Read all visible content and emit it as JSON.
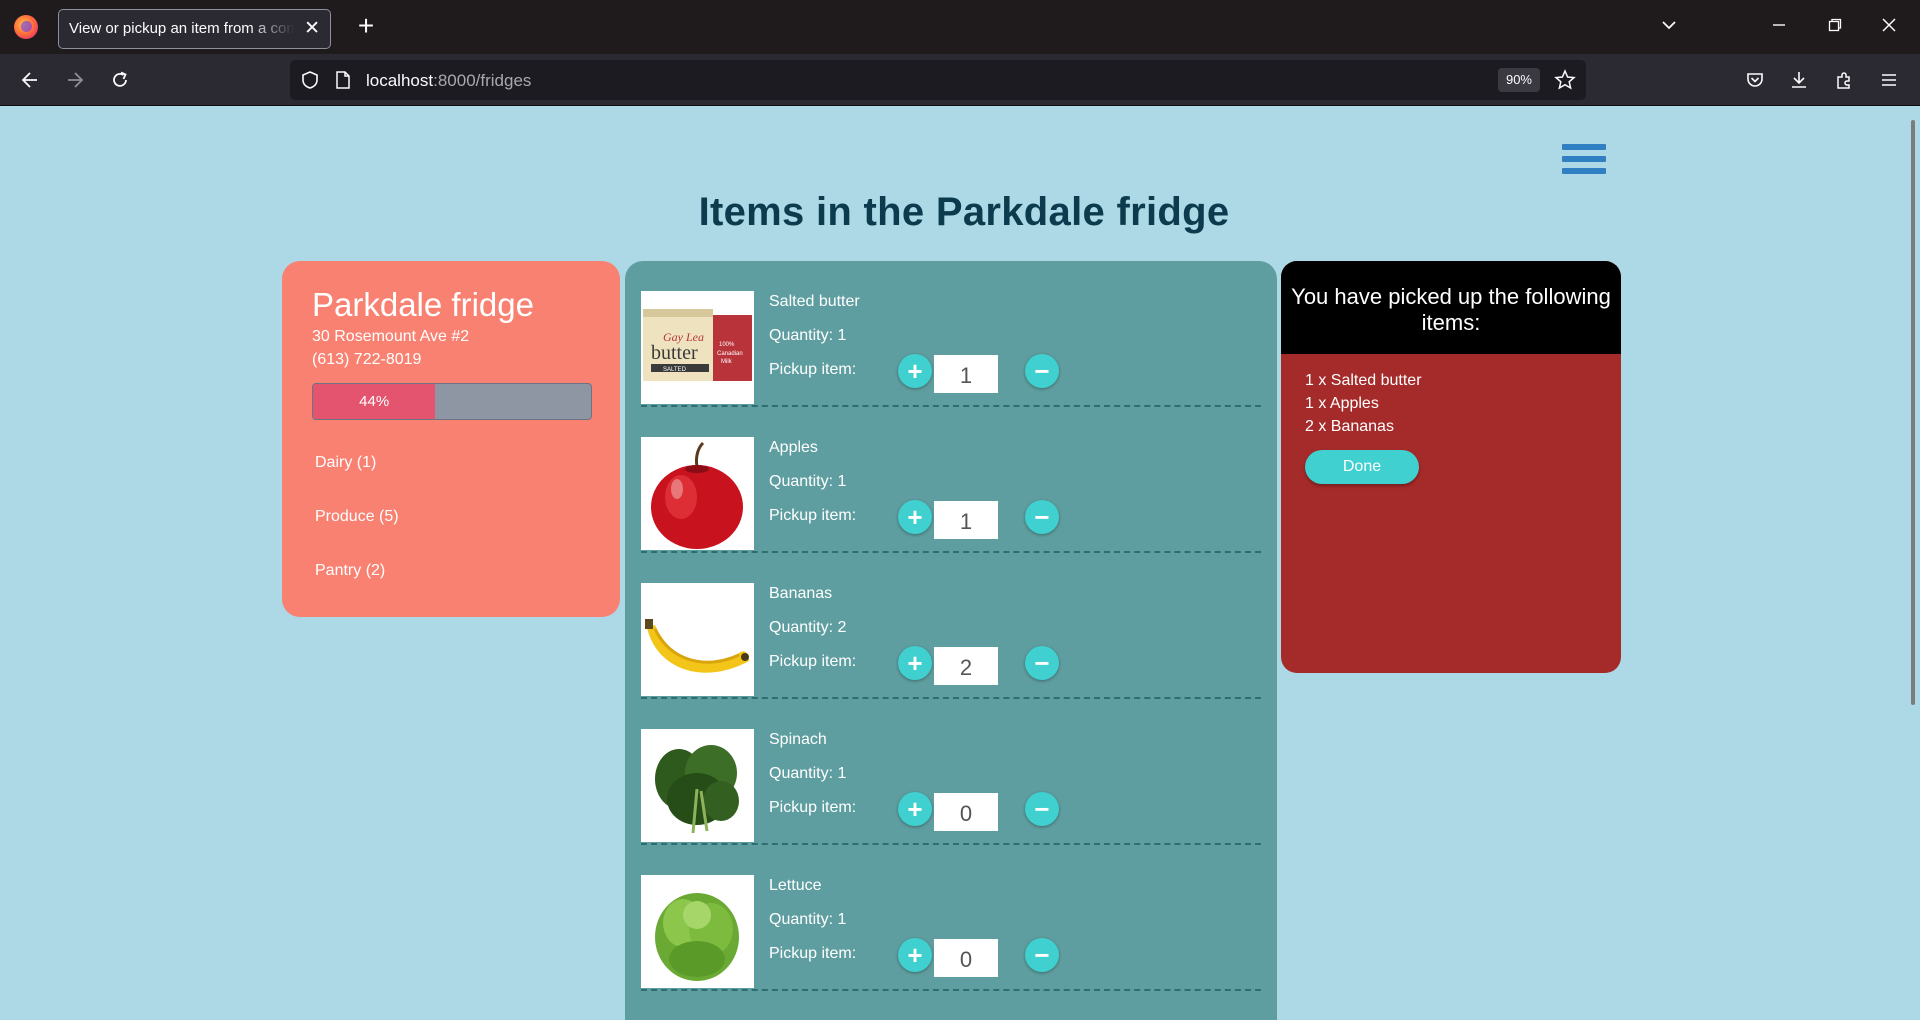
{
  "browser": {
    "tab_title": "View or pickup an item from a community fridge",
    "url_host": "localhost",
    "url_rest": ":8000/fridges",
    "zoom": "90%"
  },
  "page": {
    "title": "Items in the Parkdale fridge"
  },
  "fridge": {
    "name": "Parkdale fridge",
    "address": "30 Rosemount Ave #2",
    "phone": "(613) 722-8019",
    "capacity_percent": 44,
    "capacity_label": "44%",
    "categories": [
      {
        "label": "Dairy (1)"
      },
      {
        "label": "Produce (5)"
      },
      {
        "label": "Pantry (2)"
      }
    ]
  },
  "items": [
    {
      "name": "Salted butter",
      "quantity": "Quantity: 1",
      "pickup_label": "Pickup item:",
      "count": "1",
      "icon": "butter-image"
    },
    {
      "name": "Apples",
      "quantity": "Quantity: 1",
      "pickup_label": "Pickup item:",
      "count": "1",
      "icon": "apple-image"
    },
    {
      "name": "Bananas",
      "quantity": "Quantity: 2",
      "pickup_label": "Pickup item:",
      "count": "2",
      "icon": "banana-image"
    },
    {
      "name": "Spinach",
      "quantity": "Quantity: 1",
      "pickup_label": "Pickup item:",
      "count": "0",
      "icon": "spinach-image"
    },
    {
      "name": "Lettuce",
      "quantity": "Quantity: 1",
      "pickup_label": "Pickup item:",
      "count": "0",
      "icon": "lettuce-image"
    }
  ],
  "picked": {
    "heading": "You have picked up the following items:",
    "lines": [
      "1 x Salted butter",
      "1 x Apples",
      "2 x Bananas"
    ],
    "done_label": "Done"
  },
  "colors": {
    "page_bg": "#add8e6",
    "info_card": "#f98172",
    "items_panel": "#5f9ea0",
    "picked_card": "#a52a2a",
    "accent_button": "#40d0d0",
    "progress_fill": "#e5546f",
    "title_text": "#0b3b4d"
  }
}
